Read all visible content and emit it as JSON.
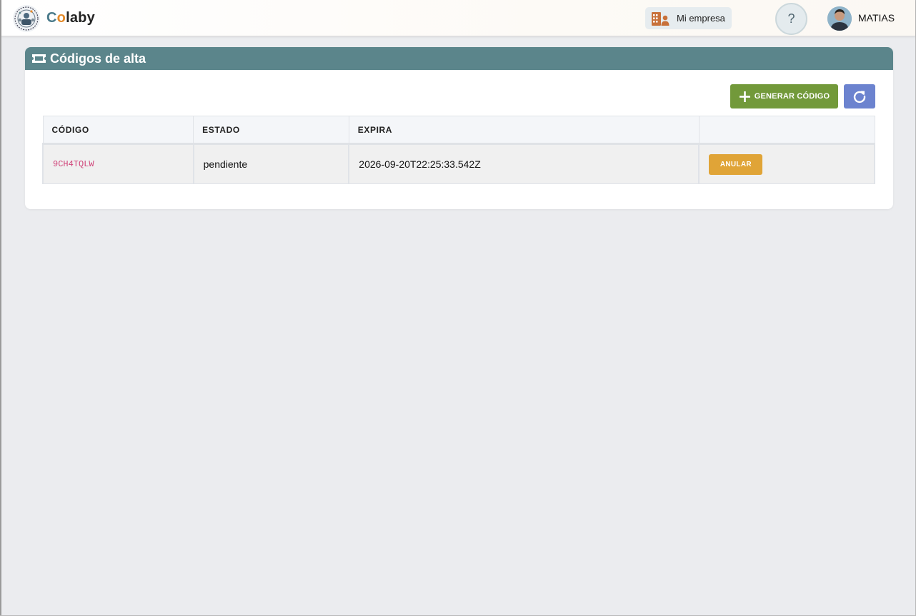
{
  "app": {
    "brand_c": "C",
    "brand_o": "o",
    "brand_rest": "laby"
  },
  "header": {
    "company_label": "Mi empresa",
    "help_label": "?",
    "user_name": "MATIAS"
  },
  "page": {
    "title": "Códigos de alta"
  },
  "toolbar": {
    "generate_label": "GENERAR CÓDIGO"
  },
  "table": {
    "columns": [
      "CÓDIGO",
      "ESTADO",
      "EXPIRA",
      ""
    ],
    "rows": [
      {
        "code": "9CH4TQLW",
        "status": "pendiente",
        "expires": "2026-09-20T22:25:33.542Z",
        "action_label": "ANULAR"
      }
    ]
  },
  "colors": {
    "header_bar": "#5b858b",
    "generate_button": "#72993a",
    "refresh_button": "#6c83cf",
    "anular_button": "#e0a437",
    "code_text": "#d0457a",
    "brand_accent": "#e48a2a"
  }
}
